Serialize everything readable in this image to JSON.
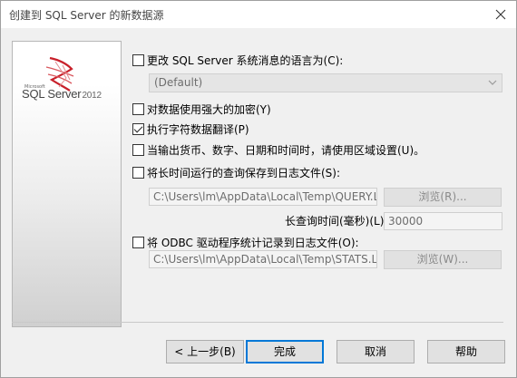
{
  "window": {
    "title": "创建到 SQL Server 的新数据源"
  },
  "brand": {
    "microsoft": "Microsoft",
    "product": "SQL Server",
    "year": "2012"
  },
  "options": {
    "change_language": {
      "label": "更改 SQL Server 系统消息的语言为(C):",
      "checked": false
    },
    "language_select": {
      "value": "(Default)"
    },
    "strong_encryption": {
      "label": "对数据使用强大的加密(Y)",
      "checked": false
    },
    "char_translation": {
      "label": "执行字符数据翻译(P)",
      "checked": true
    },
    "regional_settings": {
      "label": "当输出货币、数字、日期和时间时，请使用区域设置(U)。",
      "checked": false
    },
    "log_long_queries": {
      "label": "将长时间运行的查询保存到日志文件(S):",
      "checked": false
    },
    "query_log_path": {
      "value": "C:\\Users\\lm\\AppData\\Local\\Temp\\QUERY.LOG"
    },
    "query_browse": {
      "label": "浏览(R)..."
    },
    "query_time_label": "长查询时间(毫秒)(L):",
    "query_time_value": "30000",
    "log_odbc_stats": {
      "label": "将 ODBC 驱动程序统计记录到日志文件(O):",
      "checked": false
    },
    "stats_log_path": {
      "value": "C:\\Users\\lm\\AppData\\Local\\Temp\\STATS.LOG"
    },
    "stats_browse": {
      "label": "浏览(W)..."
    }
  },
  "buttons": {
    "back": "< 上一步(B)",
    "finish": "完成",
    "cancel": "取消",
    "help": "帮助"
  },
  "colors": {
    "default_border": "#0078d7",
    "logo_red": "#c8202a"
  }
}
